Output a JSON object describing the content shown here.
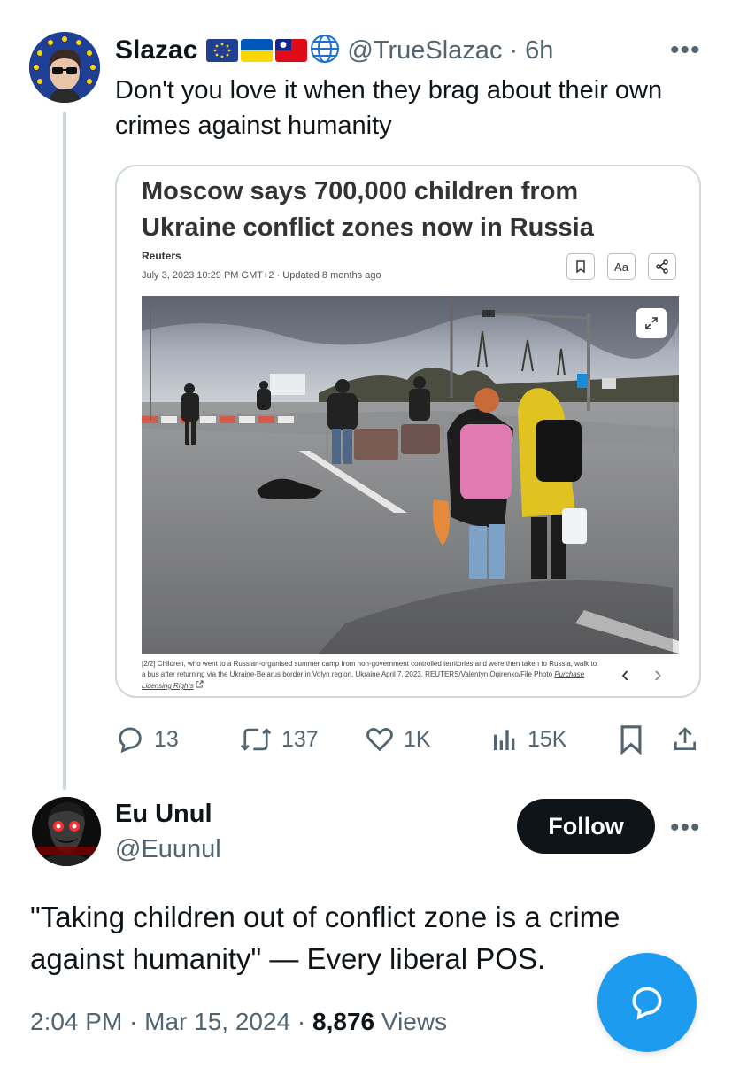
{
  "tweet1": {
    "display_name": "Slazac",
    "handle": "@TrueSlazac",
    "time": "· 6h",
    "flags": [
      "eu-flag",
      "ukraine-flag",
      "taiwan-flag",
      "globe-icon"
    ],
    "text": "Don't you love it when they brag about their own crimes against humanity",
    "card": {
      "headline": "Moscow says 700,000 children from Ukraine conflict zones now in Russia",
      "source": "Reuters",
      "date": "July 3, 2023 10:29 PM GMT+2 · Updated 8 months ago",
      "aa_label": "Aa",
      "caption": "[2/2] Children, who went to a Russian-organised summer camp from non-government controlled territories and were then taken to Russia, walk to a bus after returning via the Ukraine-Belarus border in Volyn region, Ukraine April 7, 2023. REUTERS/Valentyn Ogirenko/File Photo",
      "caption_link": "Purchase Licensing Rights"
    },
    "stats": {
      "replies": "13",
      "retweets": "137",
      "likes": "1K",
      "views": "15K"
    }
  },
  "tweet2": {
    "display_name": "Eu Unul",
    "handle": "@Euunul",
    "follow_label": "Follow",
    "text": "\"Taking children out of conflict zone is a crime against humanity\" — Every liberal POS.",
    "time": "2:04 PM · Mar 15, 2024 · ",
    "views_count": "8,876",
    "views_label": " Views"
  },
  "colors": {
    "accent": "#1d9bf0",
    "text_primary": "#0f1419",
    "text_secondary": "#536471",
    "border": "#cfd9de"
  }
}
